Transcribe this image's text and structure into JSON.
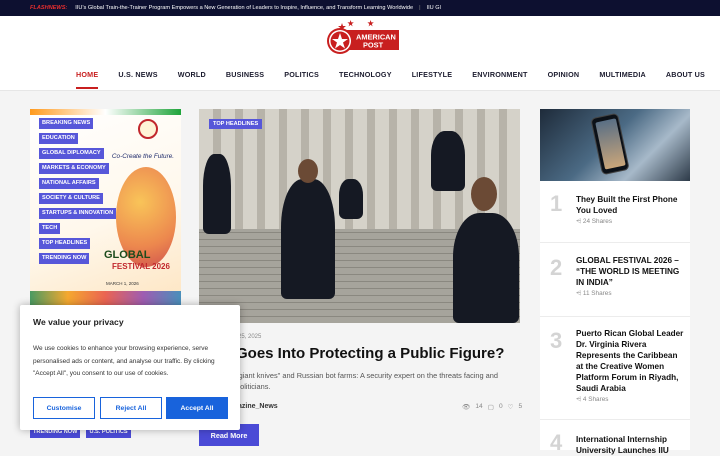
{
  "flash": {
    "label": "FLASHNEWS:",
    "items": [
      "IIU's Global Train-the-Trainer Program Empowers a New Generation of Leaders to Inspire, Influence, and Transform Learning Worldwide",
      "IIU Gl"
    ]
  },
  "logo": {
    "line1": "AMERICAN",
    "line2": "POST"
  },
  "nav": [
    "HOME",
    "U.S. NEWS",
    "WORLD",
    "BUSINESS",
    "POLITICS",
    "TECHNOLOGY",
    "LIFESTYLE",
    "ENVIRONMENT",
    "OPINION",
    "MULTIMEDIA",
    "ABOUT US"
  ],
  "categories": [
    "BREAKING NEWS",
    "EDUCATION",
    "GLOBAL DIPLOMACY",
    "MARKETS & ECONOMY",
    "NATIONAL AFFAIRS",
    "SOCIETY & CULTURE",
    "STARTUPS & INNOVATION",
    "TECH",
    "TOP HEADLINES",
    "TRENDING NOW"
  ],
  "categories2": [
    "TRENDING NOW",
    "U.S. POLITICS"
  ],
  "poster": {
    "cocreate": "Co-Create the Future.",
    "title": "GLOBAL",
    "subtitle": "FESTIVAL 2026",
    "date": "MARCH 1, 2026"
  },
  "feature": {
    "tag": "TOP HEADLINES",
    "date": "25, 2025",
    "headline": "Goes Into Protecting a Public Figure?",
    "excerpt": "\"giant knives\" and Russian bot farms: A security expert on the threats facing and politicians.",
    "author": "azine_News",
    "views": "14",
    "comments": "0",
    "likes": "5",
    "read_more": "Read More"
  },
  "sidebar": [
    {
      "num": "1",
      "title": "They Built the First Phone You Loved",
      "shares": "24 Shares"
    },
    {
      "num": "2",
      "title": "GLOBAL FESTIVAL 2026 – “THE WORLD IS MEETING IN INDIA”",
      "shares": "11 Shares"
    },
    {
      "num": "3",
      "title": "Puerto Rican Global Leader Dr. Virginia Rivera Represents the Caribbean at the Creative Women Platform Forum in Riyadh, Saudi Arabia",
      "shares": "4 Shares"
    },
    {
      "num": "4",
      "title": "International Internship University Launches IIU",
      "shares": ""
    }
  ],
  "cookie": {
    "title": "We value your privacy",
    "body": "We use cookies to enhance your browsing experience, serve personalised ads or content, and analyse our traffic. By clicking \"Accept All\", you consent to our use of cookies.",
    "customise": "Customise",
    "reject": "Reject All",
    "accept": "Accept All"
  },
  "colors": {
    "accent": "#c81f1f",
    "tag": "#5757d9",
    "cookie_blue": "#1863dc",
    "topbar": "#0d1030"
  }
}
